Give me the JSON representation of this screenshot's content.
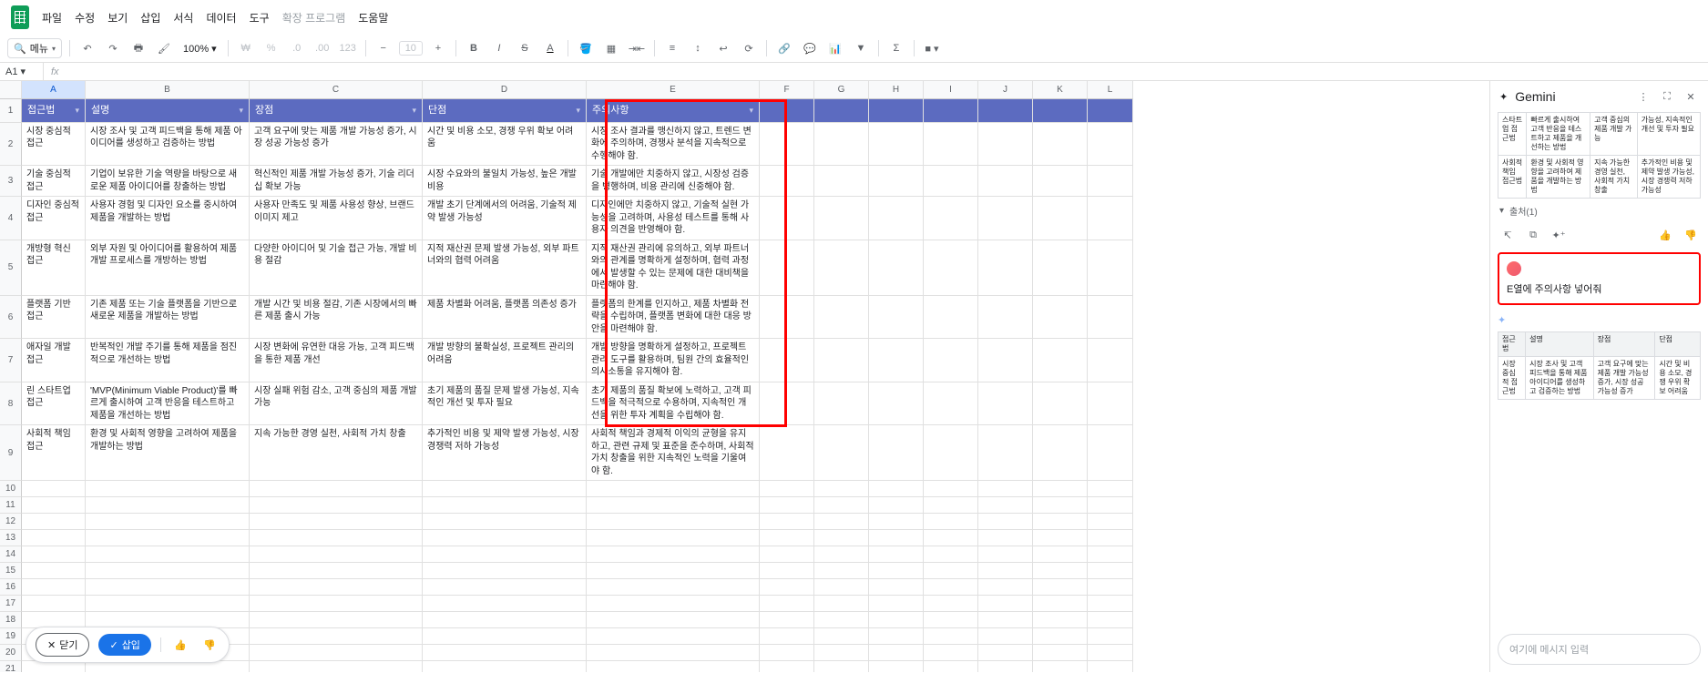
{
  "menubar": [
    "파일",
    "수정",
    "보기",
    "삽입",
    "서식",
    "데이터",
    "도구",
    "확장 프로그램",
    "도움말"
  ],
  "menubar_disabled_index": 7,
  "toolbar": {
    "menu_search": "메뉴",
    "zoom": "100%",
    "font_size": "10"
  },
  "name_box": "A1",
  "fx": "fx",
  "columns": [
    "A",
    "B",
    "C",
    "D",
    "E",
    "F",
    "G",
    "H",
    "I",
    "J",
    "K",
    "L"
  ],
  "headers": {
    "A": "접근법",
    "B": "설명",
    "C": "장점",
    "D": "단점",
    "E": "주의사항"
  },
  "rows": [
    {
      "n": "2",
      "A": "시장 중심적 접근",
      "B": "시장 조사 및 고객 피드백을 통해 제품 아이디어를 생성하고 검증하는 방법",
      "C": "고객 요구에 맞는 제품 개발 가능성 증가, 시장 성공 가능성 증가",
      "D": "시간 및 비용 소모, 경쟁 우위 확보 어려움",
      "E": "시장 조사 결과를 맹신하지 않고, 트렌드 변화에 주의하며, 경쟁사 분석을 지속적으로 수행해야 함."
    },
    {
      "n": "3",
      "A": "기술 중심적 접근",
      "B": "기업이 보유한 기술 역량을 바탕으로 새로운 제품 아이디어를 창출하는 방법",
      "C": "혁신적인 제품 개발 가능성 증가, 기술 리더십 확보 가능",
      "D": "시장 수요와의 불일치 가능성, 높은 개발 비용",
      "E": "기술 개발에만 치중하지 않고, 시장성 검증을 병행하며, 비용 관리에 신중해야 함."
    },
    {
      "n": "4",
      "A": "디자인 중심적 접근",
      "B": "사용자 경험 및 디자인 요소를 중시하여 제품을 개발하는 방법",
      "C": "사용자 만족도 및 제품 사용성 향상, 브랜드 이미지 제고",
      "D": "개발 초기 단계에서의 어려움, 기술적 제약 발생 가능성",
      "E": "디자인에만 치중하지 않고, 기술적 실현 가능성을 고려하며, 사용성 테스트를 통해 사용자 의견을 반영해야 함."
    },
    {
      "n": "5",
      "A": "개방형 혁신 접근",
      "B": "외부 자원 및 아이디어를 활용하여 제품 개발 프로세스를 개방하는 방법",
      "C": "다양한 아이디어 및 기술 접근 가능, 개발 비용 절감",
      "D": "지적 재산권 문제 발생 가능성, 외부 파트너와의 협력 어려움",
      "E": "지적 재산권 관리에 유의하고, 외부 파트너와의 관계를 명확하게 설정하며, 협력 과정에서 발생할 수 있는 문제에 대한 대비책을 마련해야 함."
    },
    {
      "n": "6",
      "A": "플랫폼 기반 접근",
      "B": "기존 제품 또는 기술 플랫폼을 기반으로 새로운 제품을 개발하는 방법",
      "C": "개발 시간 및 비용 절감, 기존 시장에서의 빠른 제품 출시 가능",
      "D": "제품 차별화 어려움, 플랫폼 의존성 증가",
      "E": "플랫폼의 한계를 인지하고, 제품 차별화 전략을 수립하며, 플랫폼 변화에 대한 대응 방안을 마련해야 함."
    },
    {
      "n": "7",
      "A": "애자일 개발 접근",
      "B": "반복적인 개발 주기를 통해 제품을 점진적으로 개선하는 방법",
      "C": "시장 변화에 유연한 대응 가능, 고객 피드백을 통한 제품 개선",
      "D": "개발 방향의 불확실성, 프로젝트 관리의 어려움",
      "E": "개발 방향을 명확하게 설정하고, 프로젝트 관리 도구를 활용하며, 팀원 간의 효율적인 의사소통을 유지해야 함."
    },
    {
      "n": "8",
      "A": "린 스타트업 접근",
      "B": "'MVP(Minimum Viable Product)'를 빠르게 출시하여 고객 반응을 테스트하고 제품을 개선하는 방법",
      "C": "시장 실패 위험 감소, 고객 중심의 제품 개발 가능",
      "D": "초기 제품의 품질 문제 발생 가능성, 지속적인 개선 및 투자 필요",
      "E": "초기 제품의 품질 확보에 노력하고, 고객 피드백을 적극적으로 수용하며, 지속적인 개선을 위한 투자 계획을 수립해야 함."
    },
    {
      "n": "9",
      "A": "사회적 책임 접근",
      "B": "환경 및 사회적 영향을 고려하여 제품을 개발하는 방법",
      "C": "지속 가능한 경영 실천, 사회적 가치 창출",
      "D": "추가적인 비용 및 제약 발생 가능성, 시장 경쟁력 저하 가능성",
      "E": "사회적 책임과 경제적 이익의 균형을 유지하고, 관련 규제 및 표준을 준수하며, 사회적 가치 창출을 위한 지속적인 노력을 기울여야 함."
    }
  ],
  "empty_rows": [
    "10",
    "11",
    "12",
    "13",
    "14",
    "15",
    "16",
    "17",
    "18",
    "19",
    "20",
    "21"
  ],
  "floating": {
    "close": "닫기",
    "insert": "삽입"
  },
  "gemini": {
    "title": "Gemini",
    "top_partial": {
      "r1": [
        "스타트업 접근법",
        "빠르게 출시하여 고객 반응을 테스트하고 제품을 개선하는 방법",
        "고객 중심의 제품 개발 가능",
        "가능성, 지속적인 개선 및 투자 필요"
      ],
      "r2": [
        "사회적 책임 접근법",
        "환경 및 사회적 영향을 고려하여 제품을 개발하는 방법",
        "지속 가능한 경영 실천, 사회적 가치 창출",
        "추가적인 비용 및 제약 발생 가능성, 시장 경쟁력 저하 가능성"
      ]
    },
    "source": "출처(1)",
    "user_prompt": "E열에 주의사항 넣어줘",
    "table_headers": [
      "접근법",
      "설명",
      "장점",
      "단점"
    ],
    "table_row": [
      "시장 중심적 접근법",
      "시장 조사 및 고객 피드백을 통해 제품 아이디어를 생성하고 검증하는 방법",
      "고객 요구에 맞는 제품 개발 가능성 증가, 시장 성공 가능성 증가",
      "시간 및 비용 소모, 경쟁 우위 확보 어려움"
    ],
    "input_placeholder": "여기에 메시지 입력"
  }
}
